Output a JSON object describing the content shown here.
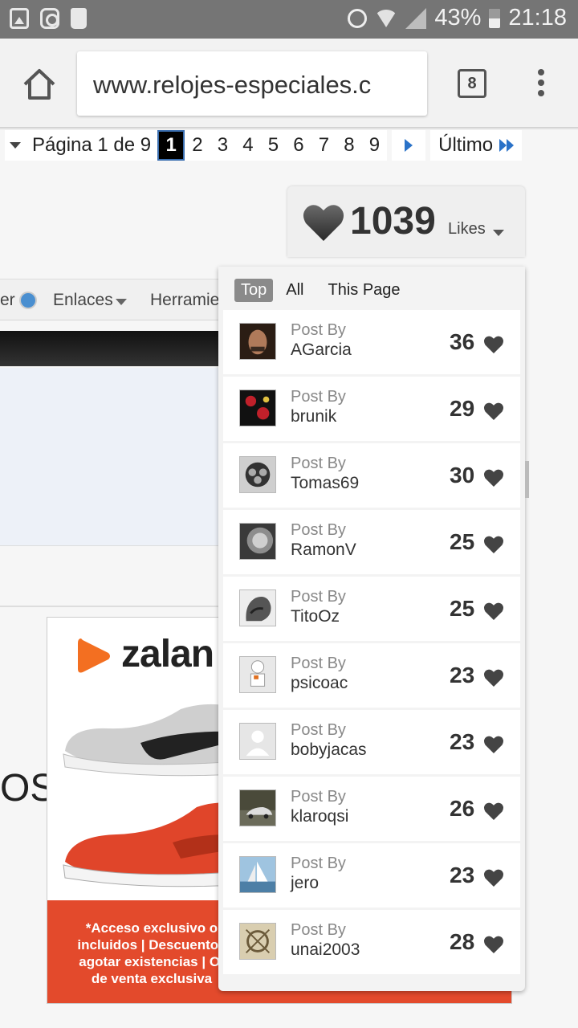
{
  "status_bar": {
    "battery": "43%",
    "time": "21:18",
    "icons": [
      "image-icon",
      "instagram-icon",
      "recorder-icon",
      "alarm-icon",
      "wifi-icon",
      "signal-icon",
      "battery-icon"
    ]
  },
  "browser": {
    "url": "www.relojes-especiales.c",
    "tab_count": "8"
  },
  "pagination": {
    "label": "Página 1 de 9",
    "pages": [
      "1",
      "2",
      "3",
      "4",
      "5",
      "6",
      "7",
      "8",
      "9"
    ],
    "current": "1",
    "last_label": "Último"
  },
  "nav": {
    "item1": "er",
    "item2": "Enlaces",
    "item3": "Herramie"
  },
  "background": {
    "big_text": "OS"
  },
  "ad": {
    "brand": "zalan",
    "lines": [
      "*Acceso exclusivo o",
      "incluidos | Descuentos",
      "agotar existencias | Of",
      "de venta exclusiva"
    ],
    "colors": {
      "brand_orange": "#f36f21",
      "banner_red": "#e34a2c"
    }
  },
  "likes": {
    "count": "1039",
    "label": "Likes",
    "tabs": [
      "Top",
      "All",
      "This Page"
    ],
    "active_tab": "Top",
    "entries": [
      {
        "post_by": "Post By",
        "author": "AGarcia",
        "count": "36"
      },
      {
        "post_by": "Post By",
        "author": "brunik",
        "count": "29"
      },
      {
        "post_by": "Post By",
        "author": "Tomas69",
        "count": "30"
      },
      {
        "post_by": "Post By",
        "author": "RamonV",
        "count": "25"
      },
      {
        "post_by": "Post By",
        "author": "TitoOz",
        "count": "25"
      },
      {
        "post_by": "Post By",
        "author": "psicoac",
        "count": "23"
      },
      {
        "post_by": "Post By",
        "author": "bobyjacas",
        "count": "23"
      },
      {
        "post_by": "Post By",
        "author": "klaroqsi",
        "count": "26"
      },
      {
        "post_by": "Post By",
        "author": "jero",
        "count": "23"
      },
      {
        "post_by": "Post By",
        "author": "unai2003",
        "count": "28"
      }
    ]
  }
}
